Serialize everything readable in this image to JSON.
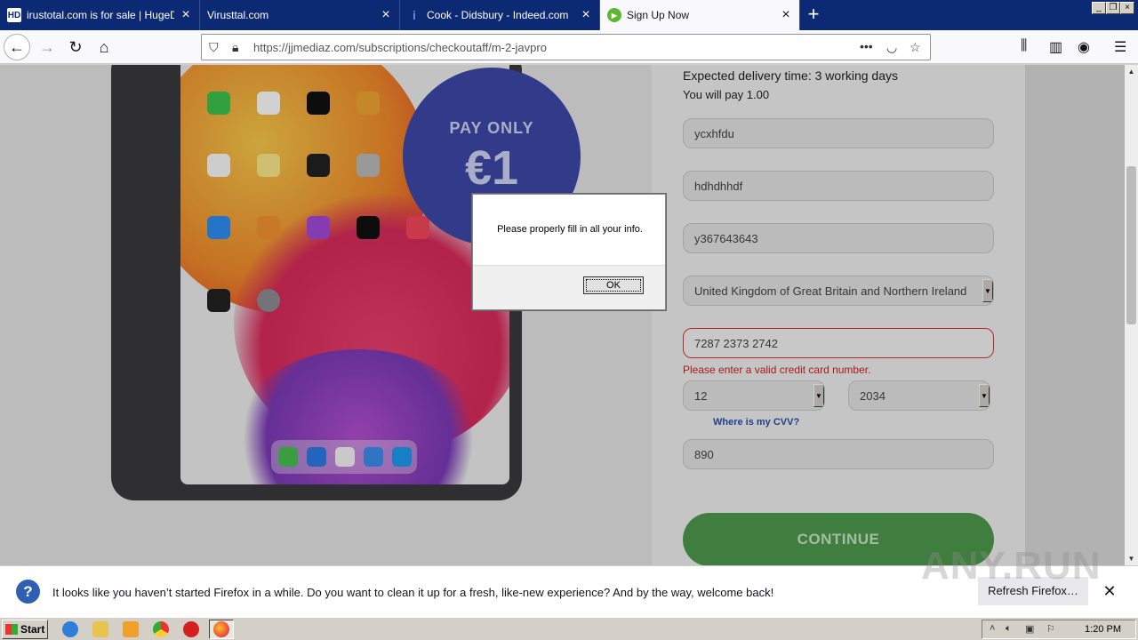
{
  "browser": {
    "tabs": [
      {
        "label": "irustotal.com is for sale | HugeDom",
        "favicon": "HD",
        "active": false
      },
      {
        "label": "Virusttal.com",
        "favicon": "",
        "active": false
      },
      {
        "label": "Cook - Didsbury - Indeed.com",
        "favicon": "i",
        "active": false
      },
      {
        "label": "Sign Up Now",
        "favicon": "play",
        "active": true
      }
    ],
    "new_tab": "+",
    "url": "https://jjmediaz.com/subscriptions/checkoutaff/m-2-javpro",
    "url_more": "•••"
  },
  "promo": {
    "line1": "PAY ONLY",
    "line2": "€1"
  },
  "form": {
    "delivery_text": "Expected delivery time: 3 working days",
    "pay_text": "You will pay 1.00",
    "first_name": "ycxhfdu",
    "last_name": "hdhdhhdf",
    "phone": "y367643643",
    "country": "United Kingdom of Great Britain and Northern Ireland",
    "card_number": "7287 2373 2742",
    "card_error": "Please enter a valid credit card number.",
    "exp_month": "12",
    "exp_year": "2034",
    "cvv_link": "Where is my CVV?",
    "cvv": "890",
    "continue_label": "CONTINUE"
  },
  "dialog": {
    "message": "Please properly fill in all your info.",
    "ok_label": "OK"
  },
  "notification": {
    "icon": "?",
    "text": "It looks like you haven’t started Firefox in a while. Do you want to clean it up for a fresh, like-new experience? And by the way, welcome back!",
    "button_label": "Refresh Firefox…",
    "close": "✕"
  },
  "watermark": "ANY.RUN",
  "taskbar": {
    "start_label": "Start",
    "clock": "1:20 PM"
  },
  "colors": {
    "promo_blue": "#3c48a8",
    "continue_green": "#4d9a4d",
    "error_red": "#cc2222",
    "tabbar_navy": "#0c2a73"
  }
}
